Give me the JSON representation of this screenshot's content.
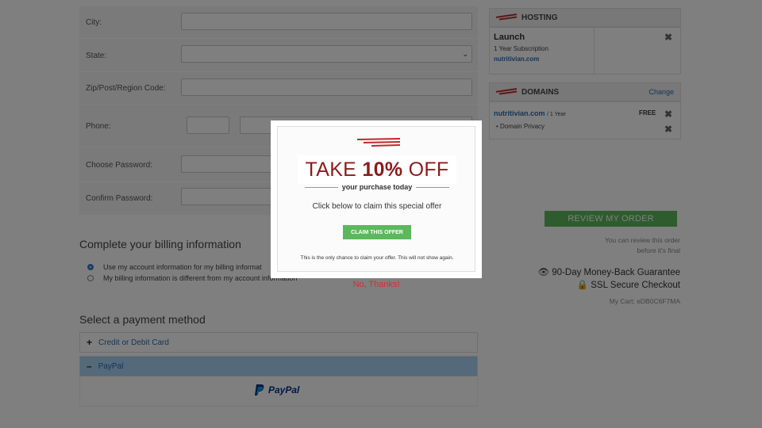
{
  "form": {
    "city_label": "City:",
    "state_label": "State:",
    "zip_label": "Zip/Post/Region Code:",
    "phone_label": "Phone:",
    "password_label": "Choose Password:",
    "confirm_label": "Confirm Password:"
  },
  "billing": {
    "title": "Complete your billing information",
    "option1": "Use my account information for my billing informat",
    "option2": "My billing information is different from my account information"
  },
  "payment": {
    "title": "Select a payment method",
    "card": "Credit or Debit Card",
    "paypal": "PayPal",
    "paypal_logo": "PayPal"
  },
  "cart": {
    "hosting_head": "HOSTING",
    "plan_name": "Launch",
    "plan_term": "1 Year Subscription",
    "plan_domain": "nutritivian.com",
    "domains_head": "DOMAINS",
    "domains_change": "Change",
    "domain_name": "nutritivian.com",
    "domain_term": "/ 1 Year",
    "domain_price": "FREE",
    "domain_privacy": "• Domain Privacy"
  },
  "review": {
    "button": "REVIEW MY ORDER",
    "note1": "You can review this order",
    "note2": "before it's final",
    "guarantee": "90-Day Money-Back Guarantee",
    "ssl": "SSL Secure Checkout",
    "cart_id": "My Cart: eDB0C6F7MA"
  },
  "modal": {
    "title_pre": "TAKE ",
    "title_bold": "10%",
    "title_post": " OFF",
    "subtitle": "your purchase today",
    "claim_text": "Click below to claim this special offer",
    "claim_button": "CLAIM THIS OFFER",
    "footnote": "This is the only chance to claim your offer. This will not show again."
  },
  "no_thanks": "No, Thanks!",
  "colors": {
    "brand_red": "#c0282d",
    "offer_red": "#8b1c1c",
    "green": "#5cb85c",
    "link_blue": "#2b6cb0",
    "paypal_blue": "#003087",
    "paypal_light": "#009cde"
  }
}
